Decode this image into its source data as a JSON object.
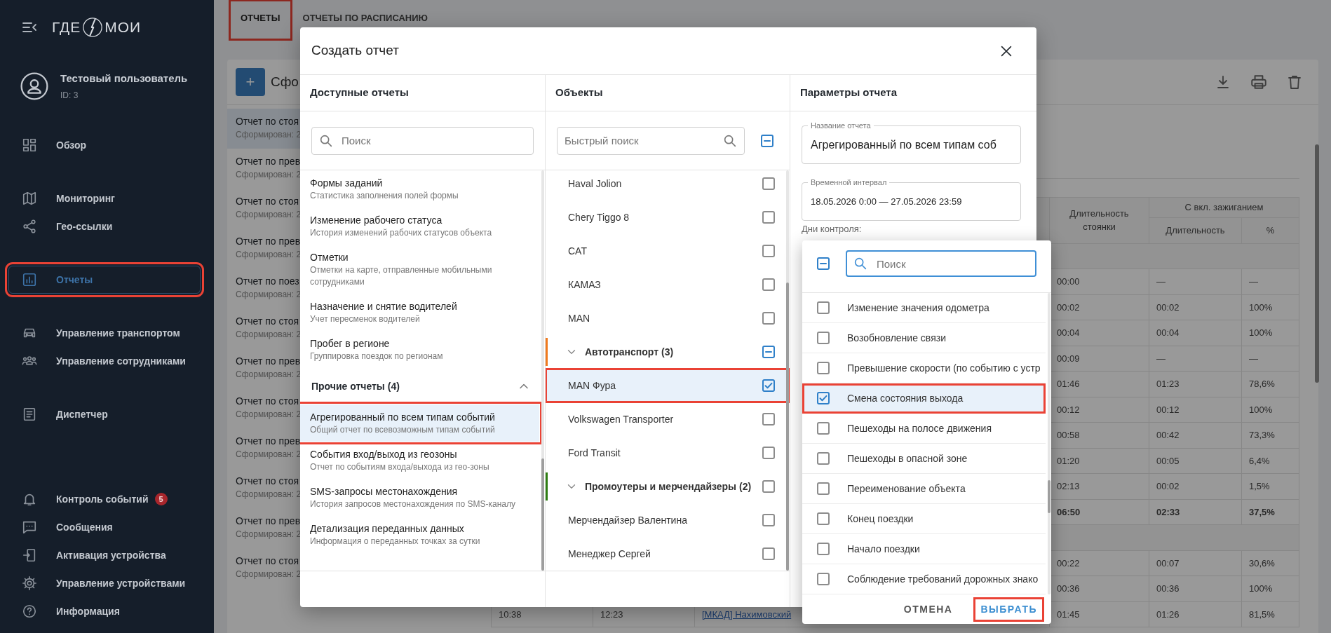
{
  "sidebar": {
    "logo": {
      "left": "ГДЕ",
      "right": "МОИ"
    },
    "user": {
      "name": "Тестовый пользователь",
      "id": "ID: 3"
    },
    "groups": [
      [
        {
          "label": "Обзор",
          "selected": false,
          "highlighted": false
        }
      ],
      [
        {
          "label": "Мониторинг",
          "selected": false,
          "highlighted": false
        },
        {
          "label": "Гео-ссылки",
          "selected": false,
          "highlighted": false
        }
      ],
      [
        {
          "label": "Отчеты",
          "selected": true,
          "highlighted": true
        }
      ],
      [
        {
          "label": "Управление транспортом",
          "selected": false,
          "highlighted": false
        },
        {
          "label": "Управление сотрудниками",
          "selected": false,
          "highlighted": false
        }
      ],
      [
        {
          "label": "Диспетчер",
          "selected": false,
          "highlighted": false
        }
      ]
    ],
    "bottom_items": [
      {
        "label": "Контроль событий",
        "badge": "5",
        "selected": false,
        "highlighted": false
      },
      {
        "label": "Сообщения",
        "selected": false,
        "highlighted": false
      },
      {
        "label": "Активация устройства",
        "selected": false,
        "highlighted": false
      },
      {
        "label": "Управление устройствами",
        "selected": false,
        "highlighted": false
      },
      {
        "label": "Информация",
        "selected": false,
        "highlighted": false
      }
    ]
  },
  "tabs": [
    {
      "label": "ОТЧЕТЫ",
      "selected": true,
      "highlighted": true
    },
    {
      "label": "ОТЧЕТЫ ПО РАСПИСАНИЮ",
      "selected": false,
      "highlighted": false
    }
  ],
  "reports": {
    "add_button": "+",
    "title": "Сфо",
    "items": [
      {
        "title": "Отчет по стоя",
        "subtitle": "Сформирован: 2",
        "selected": true
      },
      {
        "title": "Отчет по прев",
        "subtitle": "Сформирован: 2",
        "selected": false
      },
      {
        "title": "Отчет по стоя",
        "subtitle": "Сформирован: 2",
        "selected": false
      },
      {
        "title": "Отчет по прев",
        "subtitle": "Сформирован: 2",
        "selected": false
      },
      {
        "title": "Отчет по поез",
        "subtitle": "Сформирован: 2",
        "selected": false
      },
      {
        "title": "Отчет по стоя",
        "subtitle": "Сформирован: 2",
        "selected": false
      },
      {
        "title": "Отчет по прев",
        "subtitle": "Сформирован: 2",
        "selected": false
      },
      {
        "title": "Отчет по стоя",
        "subtitle": "Сформирован: 2",
        "selected": false
      },
      {
        "title": "Отчет по прев",
        "subtitle": "Сформирован: 2",
        "selected": false
      },
      {
        "title": "Отчет по стоя",
        "subtitle": "Сформирован: 2",
        "selected": false
      },
      {
        "title": "Отчет по прев",
        "subtitle": "Сформирован: 2",
        "selected": false
      },
      {
        "title": "Отчет по стоя",
        "subtitle": "Сформирован: 2",
        "selected": false
      }
    ]
  },
  "report_table": {
    "headers": {
      "parking": "Длительность стоянки",
      "ignition": "С вкл. зажиганием",
      "duration": "Длительность",
      "percent": "%"
    },
    "rows": [
      {
        "kind": "group"
      },
      {
        "kind": "data",
        "cells": [
          "00:00",
          "—",
          "—"
        ]
      },
      {
        "kind": "data",
        "cells": [
          "00:02",
          "00:02",
          "100%"
        ]
      },
      {
        "kind": "data",
        "cells": [
          "00:04",
          "00:04",
          "100%"
        ]
      },
      {
        "kind": "data",
        "cells": [
          "00:09",
          "—",
          "—"
        ]
      },
      {
        "kind": "data",
        "cells": [
          "01:46",
          "01:23",
          "78,6%"
        ]
      },
      {
        "kind": "data",
        "cells": [
          "00:12",
          "00:12",
          "100%"
        ]
      },
      {
        "kind": "data",
        "cells": [
          "00:58",
          "00:42",
          "73,3%"
        ]
      },
      {
        "kind": "data",
        "cells": [
          "01:20",
          "00:05",
          "6,4%"
        ]
      },
      {
        "kind": "data",
        "cells": [
          "02:13",
          "00:02",
          "1,5%"
        ]
      },
      {
        "kind": "total",
        "cells": [
          "06:50",
          "02:33",
          "37,5%"
        ]
      },
      {
        "kind": "group"
      },
      {
        "kind": "data",
        "cells": [
          "00:22",
          "00:07",
          "30,6%"
        ]
      },
      {
        "kind": "data",
        "cells": [
          "00:36",
          "00:36",
          "100%"
        ]
      },
      {
        "kind": "data",
        "start": "10:38",
        "end": "12:23",
        "address": "[МКАД] Нахимовский",
        "cells": [
          "01:45",
          "01:26",
          "81,5%"
        ]
      }
    ]
  },
  "modal": {
    "title": "Создать отчет",
    "reports_column": {
      "heading": "Доступные отчеты",
      "search": {
        "placeholder": "Поиск"
      },
      "items": [
        {
          "kind": "report",
          "title": "Формы заданий",
          "description": "Статистика заполнения полей формы",
          "selected": false,
          "highlighted": false
        },
        {
          "kind": "report",
          "title": "Изменение рабочего статуса",
          "description": "История изменений рабочих статусов объекта",
          "selected": false,
          "highlighted": false
        },
        {
          "kind": "report",
          "title": "Отметки",
          "description": "Отметки на карте, отправленные мобильными сотрудниками",
          "selected": false,
          "highlighted": false
        },
        {
          "kind": "report",
          "title": "Назначение и снятие водителей",
          "description": "Учет пересменок водителей",
          "selected": false,
          "highlighted": false
        },
        {
          "kind": "report",
          "title": "Пробег в регионе",
          "description": "Группировка поездок по регионам",
          "selected": false,
          "highlighted": false
        },
        {
          "kind": "group",
          "title": "Прочие отчеты (4)",
          "expanded": true
        },
        {
          "kind": "report",
          "title": "Агрегированный по всем типам событий",
          "description": "Общий отчет по всевозможным типам событий",
          "selected": true,
          "highlighted": true
        },
        {
          "kind": "report",
          "title": "События вход/выход из геозоны",
          "description": "Отчет по событиям входа/выхода из гео-зоны",
          "selected": false,
          "highlighted": false
        },
        {
          "kind": "report",
          "title": "SMS-запросы местонахождения",
          "description": "История запросов местонахождения по SMS-каналу",
          "selected": false,
          "highlighted": false
        },
        {
          "kind": "report",
          "title": "Детализация переданных данных",
          "description": "Информация о переданных точках за сутки",
          "selected": false,
          "highlighted": false
        }
      ]
    },
    "objects_column": {
      "heading": "Объекты",
      "search": {
        "placeholder": "Быстрый поиск"
      },
      "select_all": {
        "checked": false,
        "partial": true
      },
      "items": [
        {
          "kind": "object",
          "name": "Haval Jolion",
          "checked": false,
          "highlighted": false
        },
        {
          "kind": "object",
          "name": "Chery Tiggo 8",
          "checked": false,
          "highlighted": false
        },
        {
          "kind": "object",
          "name": "CAT",
          "checked": false,
          "highlighted": false
        },
        {
          "kind": "object",
          "name": "КАМАЗ",
          "checked": false,
          "highlighted": false
        },
        {
          "kind": "object",
          "name": "MAN",
          "checked": false,
          "highlighted": false
        },
        {
          "kind": "group",
          "name": "Автотранспорт (3)",
          "color": "#f07a1e",
          "expanded": true,
          "checked": false,
          "partial": true
        },
        {
          "kind": "object",
          "name": "MAN Фура",
          "checked": true,
          "highlighted": true
        },
        {
          "kind": "object",
          "name": "Volkswagen Transporter",
          "checked": false,
          "highlighted": false
        },
        {
          "kind": "object",
          "name": "Ford Transit",
          "checked": false,
          "highlighted": false
        },
        {
          "kind": "group",
          "name": "Промоутеры и мерчендайзеры (2)",
          "color": "#2e7d12",
          "expanded": true,
          "checked": false,
          "partial": false
        },
        {
          "kind": "object",
          "name": "Мерчендайзер Валентина",
          "checked": false,
          "highlighted": false
        },
        {
          "kind": "object",
          "name": "Менеджер Сергей",
          "checked": false,
          "highlighted": false
        }
      ]
    },
    "params_column": {
      "heading": "Параметры отчета",
      "fields": [
        {
          "label": "Название отчета",
          "value": "Агрегированный по всем типам соб"
        },
        {
          "label": "Временной интервал",
          "value": "18.05.2026 0:00 — 27.05.2026 23:59"
        }
      ],
      "days_label": "Дни контроля:"
    }
  },
  "event_picker": {
    "select_all": {
      "checked": false,
      "partial": true
    },
    "search": {
      "placeholder": "Поиск",
      "focused": true
    },
    "items": [
      {
        "label": "Изменение значения одометра",
        "checked": false,
        "highlighted": false
      },
      {
        "label": "Возобновление связи",
        "checked": false,
        "highlighted": false
      },
      {
        "label": "Превышение скорости (по событию с устр",
        "checked": false,
        "highlighted": false
      },
      {
        "label": "Смена состояния выхода",
        "checked": true,
        "highlighted": true
      },
      {
        "label": "Пешеходы на полосе движения",
        "checked": false,
        "highlighted": false
      },
      {
        "label": "Пешеходы в опасной зоне",
        "checked": false,
        "highlighted": false
      },
      {
        "label": "Переименование объекта",
        "checked": false,
        "highlighted": false
      },
      {
        "label": "Конец поездки",
        "checked": false,
        "highlighted": false
      },
      {
        "label": "Начало поездки",
        "checked": false,
        "highlighted": false
      },
      {
        "label": "Соблюдение требований дорожных знако",
        "checked": false,
        "highlighted": false
      }
    ],
    "cancel": "ОТМЕНА",
    "confirm": {
      "label": "ВЫБРАТЬ",
      "highlighted": true
    }
  }
}
